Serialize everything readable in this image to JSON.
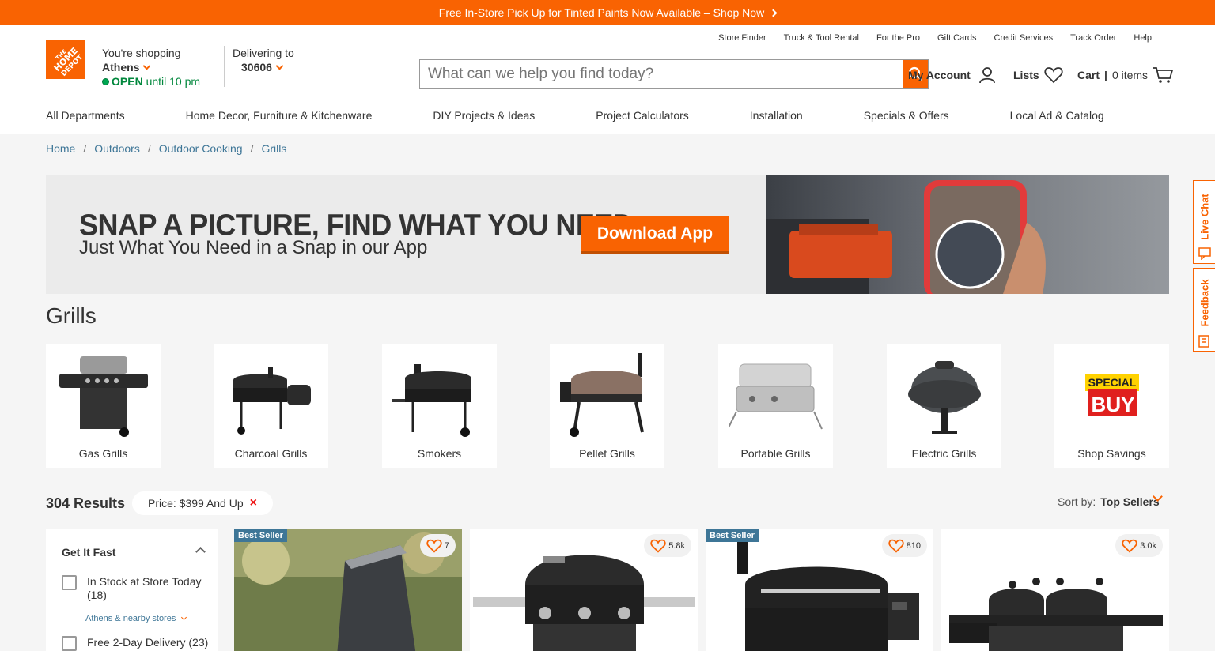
{
  "promo": {
    "text": "Free In-Store Pick Up for Tinted Paints Now Available – Shop Now"
  },
  "store": {
    "line1": "You're shopping",
    "city": "Athens",
    "open": "OPEN",
    "hours": "until 10 pm"
  },
  "delivery": {
    "label": "Delivering to",
    "zip": "30606"
  },
  "utility_links": [
    "Store Finder",
    "Truck & Tool Rental",
    "For the Pro",
    "Gift Cards",
    "Credit Services",
    "Track Order",
    "Help"
  ],
  "search": {
    "placeholder": "What can we help you find today?"
  },
  "account": {
    "label": "My Account"
  },
  "lists": {
    "label": "Lists"
  },
  "cart": {
    "label": "Cart",
    "sep": "|",
    "items": "0 items"
  },
  "nav": [
    "All Departments",
    "Home Decor, Furniture & Kitchenware",
    "DIY Projects & Ideas",
    "Project Calculators",
    "Installation",
    "Specials & Offers",
    "Local Ad & Catalog"
  ],
  "breadcrumb": [
    "Home",
    "Outdoors",
    "Outdoor Cooking",
    "Grills"
  ],
  "banner": {
    "headline": "SNAP A PICTURE, FIND WHAT YOU NEED",
    "sub": "Just What You Need in a Snap in our App",
    "cta": "Download App"
  },
  "page_title": "Grills",
  "categories": [
    {
      "label": "Gas Grills",
      "icon": "gas-grill-icon"
    },
    {
      "label": "Charcoal Grills",
      "icon": "charcoal-grill-icon"
    },
    {
      "label": "Smokers",
      "icon": "smoker-icon"
    },
    {
      "label": "Pellet Grills",
      "icon": "pellet-grill-icon"
    },
    {
      "label": "Portable Grills",
      "icon": "portable-grill-icon"
    },
    {
      "label": "Electric Grills",
      "icon": "electric-grill-icon"
    },
    {
      "label": "Shop Savings",
      "icon": "special-buy-icon",
      "badge_top": "SPECIAL",
      "badge_bottom": "BUY"
    }
  ],
  "results": {
    "count": "304 Results",
    "filter": "Price: $399 And Up",
    "remove": "×",
    "sort_label": "Sort by:",
    "sort_value": "Top Sellers"
  },
  "filters": {
    "section": "Get It Fast",
    "options": [
      {
        "label": "In Stock at Store Today",
        "count": "(18)"
      },
      {
        "label": "Free 2-Day Delivery (23)"
      }
    ],
    "nearby": "Athens & nearby stores"
  },
  "products": [
    {
      "badge": "Best Seller",
      "favs": "7"
    },
    {
      "badge": "",
      "favs": "5.8k"
    },
    {
      "badge": "Best Seller",
      "favs": "810"
    },
    {
      "badge": "",
      "favs": "3.0k"
    }
  ],
  "side_tabs": {
    "chat": "Live Chat",
    "feedback": "Feedback"
  },
  "colors": {
    "brand": "#f96302",
    "link": "#3e7697",
    "open": "#00873c",
    "badge": "#3e7697"
  }
}
